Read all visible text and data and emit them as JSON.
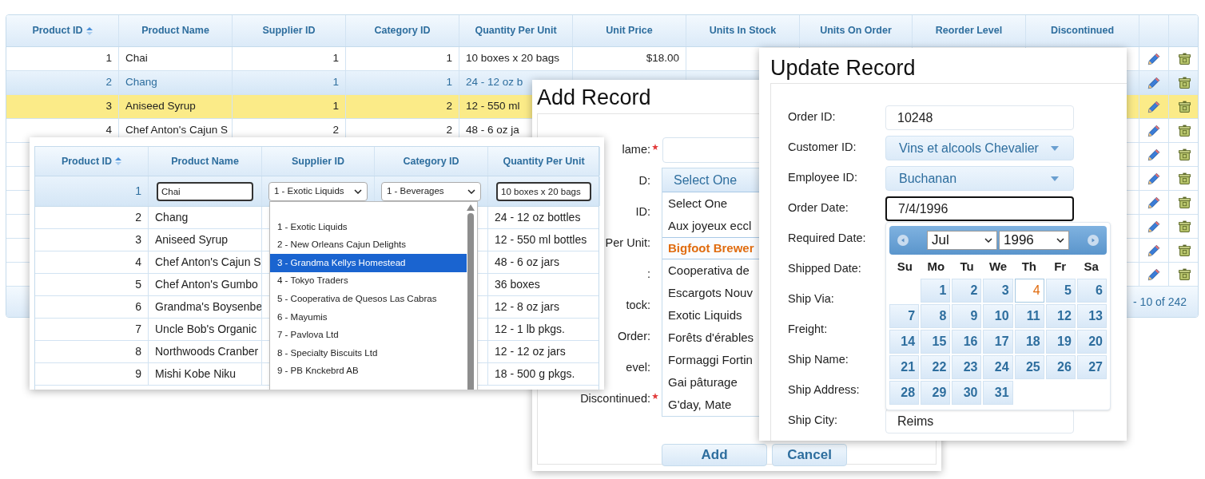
{
  "main_table": {
    "columns": [
      {
        "label": "Product ID",
        "kind": "number",
        "sorted": true
      },
      {
        "label": "Product Name",
        "kind": "text",
        "sorted": false
      },
      {
        "label": "Supplier ID",
        "kind": "number",
        "sorted": false
      },
      {
        "label": "Category ID",
        "kind": "number",
        "sorted": false
      },
      {
        "label": "Quantity Per Unit",
        "kind": "text",
        "sorted": false
      },
      {
        "label": "Unit Price",
        "kind": "number",
        "sorted": false
      },
      {
        "label": "Units In Stock",
        "kind": "number",
        "sorted": false
      },
      {
        "label": "Units On Order",
        "kind": "number",
        "sorted": false
      },
      {
        "label": "Reorder Level",
        "kind": "number",
        "sorted": false
      },
      {
        "label": "Discontinued",
        "kind": "text",
        "sorted": false
      }
    ],
    "rows": [
      {
        "cells": [
          "1",
          "Chai",
          "1",
          "1",
          "10 boxes x 20 bags",
          "$18.00"
        ],
        "selected": false,
        "hovered": false
      },
      {
        "cells": [
          "2",
          "Chang",
          "1",
          "1",
          "24 - 12 oz b"
        ],
        "selected": false,
        "hovered": true
      },
      {
        "cells": [
          "3",
          "Aniseed Syrup",
          "1",
          "2",
          "12 - 550 ml"
        ],
        "selected": true,
        "hovered": false
      },
      {
        "cells": [
          "4",
          "Chef Anton's Cajun S",
          "2",
          "2",
          "48 - 6 oz ja"
        ],
        "selected": false,
        "hovered": false
      },
      {
        "selected": false,
        "hovered": false
      },
      {
        "selected": false,
        "hovered": false
      },
      {
        "selected": false,
        "hovered": false
      },
      {
        "selected": false,
        "hovered": false
      },
      {
        "selected": false,
        "hovered": false
      },
      {
        "selected": false,
        "hovered": false
      }
    ],
    "page_info": "- 10 of 242"
  },
  "product_editor": {
    "columns": [
      {
        "label": "Product ID",
        "sorted": true
      },
      {
        "label": "Product Name",
        "sorted": false
      },
      {
        "label": "Supplier ID",
        "sorted": false
      },
      {
        "label": "Category ID",
        "sorted": false
      },
      {
        "label": "Quantity Per Unit",
        "sorted": false
      }
    ],
    "edit_row": {
      "id": "1",
      "name": "Chai",
      "supplier": "1 - Exotic Liquids",
      "category": "1 - Beverages",
      "quantity": "10 boxes x 20 bags"
    },
    "rows": [
      {
        "id": "2",
        "name": "Chang",
        "quantity": "24 - 12 oz bottles"
      },
      {
        "id": "3",
        "name": "Aniseed Syrup",
        "quantity": "12 - 550 ml bottles"
      },
      {
        "id": "4",
        "name": "Chef Anton's Cajun S",
        "quantity": "48 - 6 oz jars"
      },
      {
        "id": "5",
        "name": "Chef Anton's Gumbo",
        "quantity": "36 boxes"
      },
      {
        "id": "6",
        "name": "Grandma's Boysenbe",
        "quantity": "12 - 8 oz jars"
      },
      {
        "id": "7",
        "name": "Uncle Bob's Organic",
        "quantity": "12 - 1 lb pkgs."
      },
      {
        "id": "8",
        "name": "Northwoods Cranber",
        "quantity": "12 - 12 oz jars"
      },
      {
        "id": "9",
        "name": "Mishi Kobe Niku",
        "quantity": "18 - 500 g pkgs."
      }
    ],
    "supplier_options": [
      {
        "label": "1 - Exotic Liquids",
        "selected": false
      },
      {
        "label": "2 - New Orleans Cajun Delights",
        "selected": false
      },
      {
        "label": "3 - Grandma Kellys Homestead",
        "selected": true
      },
      {
        "label": "4 - Tokyo Traders",
        "selected": false
      },
      {
        "label": "5 - Cooperativa de Quesos Las Cabras",
        "selected": false
      },
      {
        "label": "6 - Mayumis",
        "selected": false
      },
      {
        "label": "7 - Pavlova Ltd",
        "selected": false
      },
      {
        "label": "8 - Specialty Biscuits Ltd",
        "selected": false
      },
      {
        "label": "9 - PB Knckebrd AB",
        "selected": false
      }
    ]
  },
  "add_record": {
    "title": "Add Record",
    "rows": [
      {
        "label": "lame:",
        "required": true
      },
      {
        "label": "D:",
        "required": false
      },
      {
        "label": "ID:",
        "required": false
      },
      {
        "label": "Per Unit:",
        "required": false
      },
      {
        "label": ":",
        "required": false
      },
      {
        "label": "tock:",
        "required": false
      },
      {
        "label": "Order:",
        "required": false
      },
      {
        "label": "evel:",
        "required": false
      },
      {
        "label": "Discontinued:",
        "required": true
      }
    ],
    "supplier_list": {
      "value": "Select One",
      "options": [
        {
          "label": "Select One",
          "highlighted": false
        },
        {
          "label": "Aux joyeux eccl",
          "highlighted": false
        },
        {
          "label": "Bigfoot Brewer",
          "highlighted": true
        },
        {
          "label": "Cooperativa de",
          "highlighted": false
        },
        {
          "label": "Escargots Nouv",
          "highlighted": false
        },
        {
          "label": "Exotic Liquids",
          "highlighted": false
        },
        {
          "label": "Forêts d'érables",
          "highlighted": false
        },
        {
          "label": "Formaggi Fortin",
          "highlighted": false
        },
        {
          "label": "Gai pâturage",
          "highlighted": false
        },
        {
          "label": "G'day, Mate",
          "highlighted": false
        }
      ]
    },
    "buttons": [
      "Add",
      "Cancel"
    ]
  },
  "update_record": {
    "title": "Update Record",
    "fields": [
      {
        "label": "Order ID:",
        "kind": "input",
        "value": "10248",
        "focused": false
      },
      {
        "label": "Customer ID:",
        "kind": "select",
        "value": "Vins et alcools Chevalier"
      },
      {
        "label": "Employee ID:",
        "kind": "select",
        "value": "Buchanan"
      },
      {
        "label": "Order Date:",
        "kind": "input",
        "value": "7/4/1996",
        "focused": true
      },
      {
        "label": "Required Date:"
      },
      {
        "label": "Shipped Date:"
      },
      {
        "label": "Ship Via:"
      },
      {
        "label": "Freight:"
      },
      {
        "label": "Ship Name:"
      },
      {
        "label": "Ship Address:"
      },
      {
        "label": "Ship City:",
        "kind": "input",
        "value": "Reims",
        "focused": false
      }
    ],
    "calendar": {
      "month": "Jul",
      "year": "1996",
      "weekdays": [
        "Su",
        "Mo",
        "Tu",
        "We",
        "Th",
        "Fr",
        "Sa"
      ],
      "weeks": [
        [
          {
            "day": "1",
            "selected": false
          },
          {
            "day": "2",
            "selected": false
          },
          {
            "day": "3",
            "selected": false
          },
          {
            "day": "4",
            "selected": true
          },
          {
            "day": "5",
            "selected": false
          },
          {
            "day": "6",
            "selected": false
          }
        ],
        [
          {
            "day": "7",
            "selected": false
          },
          {
            "day": "8",
            "selected": false
          },
          {
            "day": "9",
            "selected": false
          },
          {
            "day": "10",
            "selected": false
          },
          {
            "day": "11",
            "selected": false
          },
          {
            "day": "12",
            "selected": false
          },
          {
            "day": "13",
            "selected": false
          }
        ],
        [
          {
            "day": "14",
            "selected": false
          },
          {
            "day": "15",
            "selected": false
          },
          {
            "day": "16",
            "selected": false
          },
          {
            "day": "17",
            "selected": false
          },
          {
            "day": "18",
            "selected": false
          },
          {
            "day": "19",
            "selected": false
          },
          {
            "day": "20",
            "selected": false
          }
        ],
        [
          {
            "day": "21",
            "selected": false
          },
          {
            "day": "22",
            "selected": false
          },
          {
            "day": "23",
            "selected": false
          },
          {
            "day": "24",
            "selected": false
          },
          {
            "day": "25",
            "selected": false
          },
          {
            "day": "26",
            "selected": false
          },
          {
            "day": "27",
            "selected": false
          }
        ],
        [
          {
            "day": "28",
            "selected": false
          },
          {
            "day": "29",
            "selected": false
          },
          {
            "day": "30",
            "selected": false
          },
          {
            "day": "31",
            "selected": false
          }
        ]
      ]
    }
  }
}
